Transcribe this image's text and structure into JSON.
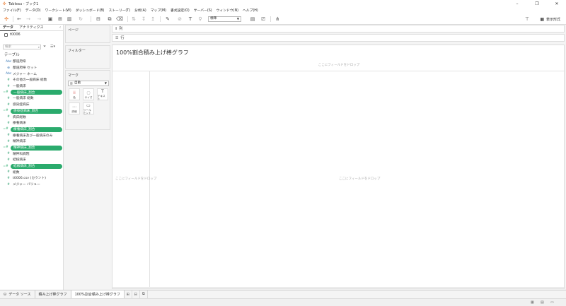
{
  "window": {
    "title": "Tableau - ブック1"
  },
  "menu": [
    "ファイル(F)",
    "データ(D)",
    "ワークシート(W)",
    "ダッシュボード(B)",
    "ストーリー(T)",
    "分析(A)",
    "マップ(M)",
    "書式設定(O)",
    "サーバー(S)",
    "ウィンドウ(N)",
    "ヘルプ(H)"
  ],
  "toolbar": {
    "standard_select": "標準",
    "show_me": "表示形式"
  },
  "left": {
    "tab_data": "データ",
    "tab_analytics": "アナリティクス",
    "datasource": "t0006",
    "search_placeholder": "検索",
    "tables_title": "テーブル",
    "fields": [
      {
        "icon": "Abc",
        "name": "都道府県",
        "kind": "dim",
        "pill": false
      },
      {
        "icon": "⊕",
        "name": "都道府県 セット",
        "kind": "dim",
        "pill": false
      },
      {
        "icon": "Abc",
        "name": "メジャー ネーム",
        "kind": "dim",
        "pill": false
      },
      {
        "icon": "#",
        "name": "その他の一般病床 総数",
        "kind": "meas",
        "pill": false
      },
      {
        "icon": "#",
        "name": "一般病床",
        "kind": "meas",
        "pill": false
      },
      {
        "icon": "=#",
        "name": "一般病床_割合",
        "kind": "meas",
        "pill": true
      },
      {
        "icon": "#",
        "name": "一般病床 総数",
        "kind": "meas",
        "pill": false
      },
      {
        "icon": "#",
        "name": "感染症病床",
        "kind": "meas",
        "pill": false
      },
      {
        "icon": "=#",
        "name": "感染症病床_割合",
        "kind": "meas",
        "pill": true
      },
      {
        "icon": "#",
        "name": "病床総数",
        "kind": "meas",
        "pill": false
      },
      {
        "icon": "#",
        "name": "療養病床",
        "kind": "meas",
        "pill": false
      },
      {
        "icon": "=#",
        "name": "療養病床_割合",
        "kind": "meas",
        "pill": true
      },
      {
        "icon": "#",
        "name": "療養病床及び一般病床のみ",
        "kind": "meas",
        "pill": false
      },
      {
        "icon": "#",
        "name": "精神病床",
        "kind": "meas",
        "pill": false
      },
      {
        "icon": "=#",
        "name": "精神病床_割合",
        "kind": "meas",
        "pill": true
      },
      {
        "icon": "#",
        "name": "精神科病院",
        "kind": "meas",
        "pill": false
      },
      {
        "icon": "#",
        "name": "結核病床",
        "kind": "meas",
        "pill": false
      },
      {
        "icon": "=#",
        "name": "結核病床_割合",
        "kind": "meas",
        "pill": true
      },
      {
        "icon": "#",
        "name": "総数",
        "kind": "meas",
        "pill": false
      },
      {
        "icon": "#",
        "name": "t0006.csv (カウント)",
        "kind": "meas",
        "pill": false
      },
      {
        "icon": "#",
        "name": "メジャー バリュー",
        "kind": "meas",
        "pill": false
      }
    ]
  },
  "cards": {
    "pages": "ページ",
    "filters": "フィルター",
    "marks": "マーク",
    "mark_type": "自動",
    "mark_buttons": [
      {
        "icon": "⁞⁞",
        "label": "色"
      },
      {
        "icon": "◌",
        "label": "サイズ"
      },
      {
        "icon": "T",
        "label": "テキスト"
      },
      {
        "icon": "⋯",
        "label": "詳細"
      },
      {
        "icon": "▭",
        "label": "ツールヒント"
      }
    ]
  },
  "shelves": {
    "columns": "列",
    "rows": "行"
  },
  "view": {
    "title": "100%割合積み上げ棒グラフ",
    "drop_field_top": "ここにフィールドをドロップ",
    "drop_field_left": "ここにフィールドをドロップ",
    "drop_field_center": "ここにフィールドをドロップ"
  },
  "bottom_tabs": {
    "datasource": "データ ソース",
    "sheets": [
      "積み上げ棒グラフ",
      "100%割合積み上げ棒グラフ"
    ],
    "active_index": 1
  }
}
